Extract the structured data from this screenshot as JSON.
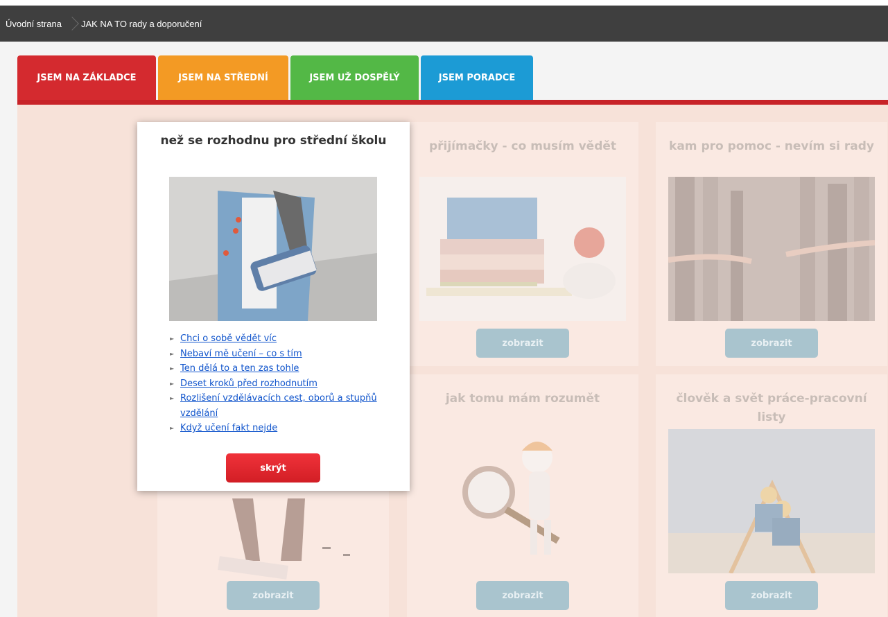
{
  "breadcrumb": {
    "home": "Úvodní strana",
    "current": "JAK NA TO rady a doporučení"
  },
  "tabs": [
    {
      "label": "JSEM NA ZÁKLADCE"
    },
    {
      "label": "JSEM NA STŘEDNÍ"
    },
    {
      "label": "JSEM UŽ DOSPĚLÝ"
    },
    {
      "label": "JSEM PORADCE"
    }
  ],
  "cards": [
    {
      "title": "přijímačky - co musím vědět",
      "button": "zobrazit"
    },
    {
      "title": "kam pro pomoc - nevím si rady",
      "button": "zobrazit"
    },
    {
      "title": "jak tomu mám rozumět",
      "button": "zobrazit"
    },
    {
      "title": "člověk a svět práce-pracovní listy",
      "button": "zobrazit"
    },
    {
      "title": "",
      "button": "zobrazit"
    }
  ],
  "popup": {
    "title": "než se rozhodnu pro střední školu",
    "links": [
      "Chci o sobě vědět víc",
      "Nebaví mě učení – co s tím",
      "Ten dělá to a ten zas tohle",
      "Deset kroků před rozhodnutím",
      "Rozlišení vzdělávacích cest, oborů a stupňů vzdělání",
      "Když učení fakt nejde"
    ],
    "hide_button": "skrýt"
  },
  "colors": {
    "tab_zakladce": "#d42a2f",
    "tab_stredni": "#f39a24",
    "tab_dospely": "#53b846",
    "tab_poradce": "#1c9bd5",
    "accent_line": "#c82328",
    "panel_bg": "#f7e2d9"
  }
}
